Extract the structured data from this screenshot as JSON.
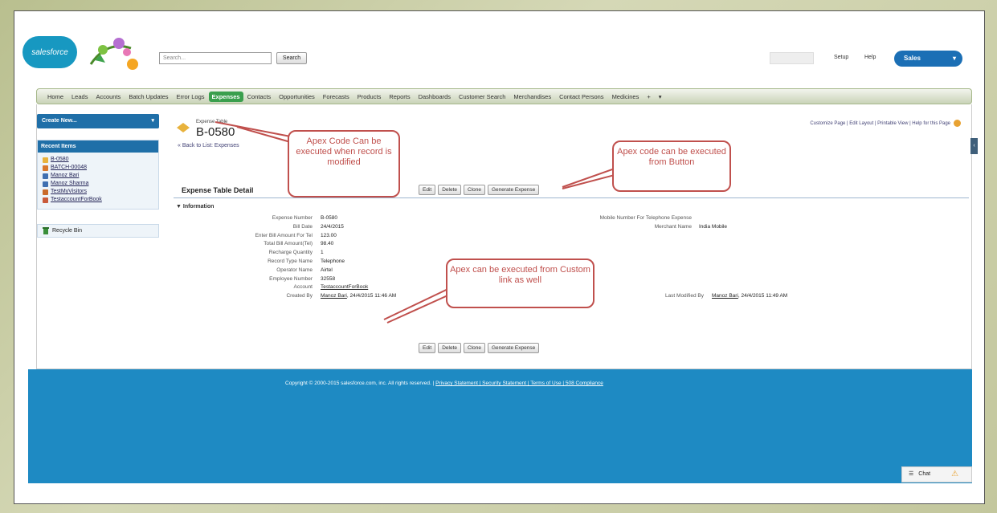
{
  "header": {
    "logo_text": "salesforce",
    "search_placeholder": "Search...",
    "search_button": "Search",
    "setup_link": "Setup",
    "help_link": "Help",
    "app_menu": "Sales",
    "app_menu_caret": "▾"
  },
  "tabs": [
    "Home",
    "Leads",
    "Accounts",
    "Batch Updates",
    "Error Logs",
    "Expenses",
    "Contacts",
    "Opportunities",
    "Forecasts",
    "Products",
    "Reports",
    "Dashboards",
    "Customer Search",
    "Merchandises",
    "Contact Persons",
    "Medicines",
    "+",
    "▾"
  ],
  "active_tab_index": 5,
  "sidebar": {
    "create_new": "Create New...",
    "create_new_caret": "▾",
    "recent_header": "Recent Items",
    "recent_items": [
      {
        "label": "B-0580",
        "color": "#e8b23c"
      },
      {
        "label": "BATCH-00048",
        "color": "#d9772b"
      },
      {
        "label": "Manoz Bari",
        "color": "#3f6fb0"
      },
      {
        "label": "Manoz Sharma",
        "color": "#3f6fb0"
      },
      {
        "label": "TestMyVisitors",
        "color": "#c96a2a"
      },
      {
        "label": "TestaccountForBook",
        "color": "#c95a3a"
      }
    ],
    "recycle_bin": "Recycle Bin"
  },
  "record": {
    "object_type": "Expense Table",
    "title": "B-0580",
    "back_link": "« Back to List: Expenses",
    "top_links": "Customize Page | Edit Layout | Printable View | Help for this Page",
    "detail_title": "Expense Table Detail",
    "buttons": [
      "Edit",
      "Delete",
      "Clone",
      "Generate Expense"
    ],
    "section_header": "▼ Information",
    "fields": [
      {
        "label": "Expense Number",
        "value": "B-0580"
      },
      {
        "label": "Bill Date",
        "value": "24/4/2015"
      },
      {
        "label": "Enter Bill Amount For Tel",
        "value": "123.00"
      },
      {
        "label": "Total Bill Amount(Tel)",
        "value": "98.40"
      },
      {
        "label": "Recharge Quantity",
        "value": "1"
      },
      {
        "label": "Record Type Name",
        "value": "Telephone"
      },
      {
        "label": "Operator Name",
        "value": "Airtel"
      },
      {
        "label": "Employee Number",
        "value": "32558"
      },
      {
        "label": "Account",
        "value": "TestaccountForBook"
      },
      {
        "label": "Created By",
        "value_link": "Manoz Bari",
        "value": ", 24/4/2015 11:46 AM"
      }
    ],
    "right_fields": [
      {
        "label": "Mobile Number For Telephone Expense",
        "value": ""
      },
      {
        "label": "Merchant Name",
        "value": "India Mobile"
      }
    ],
    "last_modified": {
      "label": "Last Modified By",
      "value_link": "Manoz Bari",
      "value": ", 24/4/2015 11:49 AM"
    }
  },
  "footer": {
    "copyright": "Copyright © 2000-2015 salesforce.com, inc. All rights reserved. |",
    "links": "Privacy Statement | Security Statement | Terms of Use | 508 Compliance"
  },
  "chat": {
    "label": "Chat"
  },
  "callouts": {
    "record_modified": "Apex Code Can be executed when record is modified",
    "button": "Apex code can be executed from Button",
    "custom_link": "Apex can be executed from Custom link as well"
  },
  "colors": {
    "brand_blue": "#1e8ac3",
    "active_tab": "#3a9f4d",
    "callout_red": "#c0504d"
  }
}
